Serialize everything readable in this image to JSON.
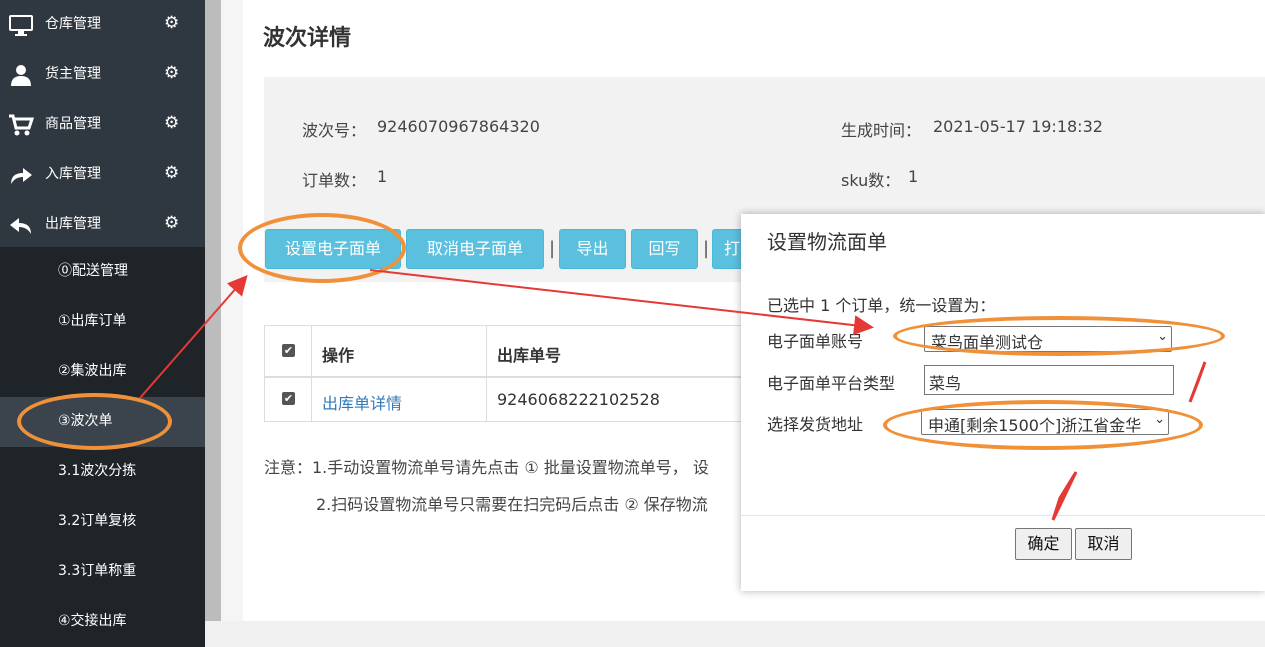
{
  "sidebar": {
    "menu": [
      {
        "label": "仓库管理",
        "icon": "monitor-icon"
      },
      {
        "label": "货主管理",
        "icon": "user-icon"
      },
      {
        "label": "商品管理",
        "icon": "cart-icon"
      },
      {
        "label": "入库管理",
        "icon": "forward-arrow-icon"
      },
      {
        "label": "出库管理",
        "icon": "reply-arrow-icon"
      }
    ],
    "submenu": [
      {
        "label": "⓪配送管理"
      },
      {
        "label": "①出库订单"
      },
      {
        "label": "②集波出库"
      },
      {
        "label": "③波次单"
      },
      {
        "label": "3.1波次分拣"
      },
      {
        "label": "3.2订单复核"
      },
      {
        "label": "3.3订单称重"
      },
      {
        "label": "④交接出库"
      }
    ]
  },
  "page": {
    "title": "波次详情",
    "wave_no_label": "波次号：",
    "wave_no": "9246070967864320",
    "created_label": "生成时间：",
    "created": "2021-05-17 19:18:32",
    "orders_label": "订单数：",
    "orders": "1",
    "sku_label": "sku数：",
    "sku": "1"
  },
  "toolbar": {
    "set_label": "设置电子面单",
    "cancel_label": "取消电子面单",
    "sep": "|",
    "export_label": "导出",
    "writeback_label": "回写",
    "print_label": "打"
  },
  "table": {
    "headers": [
      "操作",
      "出库单号"
    ],
    "rows": [
      {
        "action": "出库单详情",
        "order_no": "9246068222102528"
      }
    ]
  },
  "notes": {
    "line1": "注意：1.手动设置物流单号请先点击 ① 批量设置物流单号， 设",
    "line2": "2.扫码设置物流单号只需要在扫完码后点击 ② 保存物流"
  },
  "dialog": {
    "title": "设置物流面单",
    "summary": "已选中 1 个订单，统一设置为：",
    "account_label": "电子面单账号",
    "account_value": "菜鸟面单测试仓",
    "platform_label": "电子面单平台类型",
    "platform_value": "菜鸟",
    "address_label": "选择发货地址",
    "address_value": "申通[剩余1500个]浙江省金华",
    "confirm_label": "确定",
    "cancel_label": "取消"
  },
  "colors": {
    "sidebar": "#2f3740",
    "submenu": "#1f2429",
    "button": "#5bc0de",
    "link": "#337ab7",
    "annotation": "#f0913a",
    "arrow": "#e53935"
  }
}
